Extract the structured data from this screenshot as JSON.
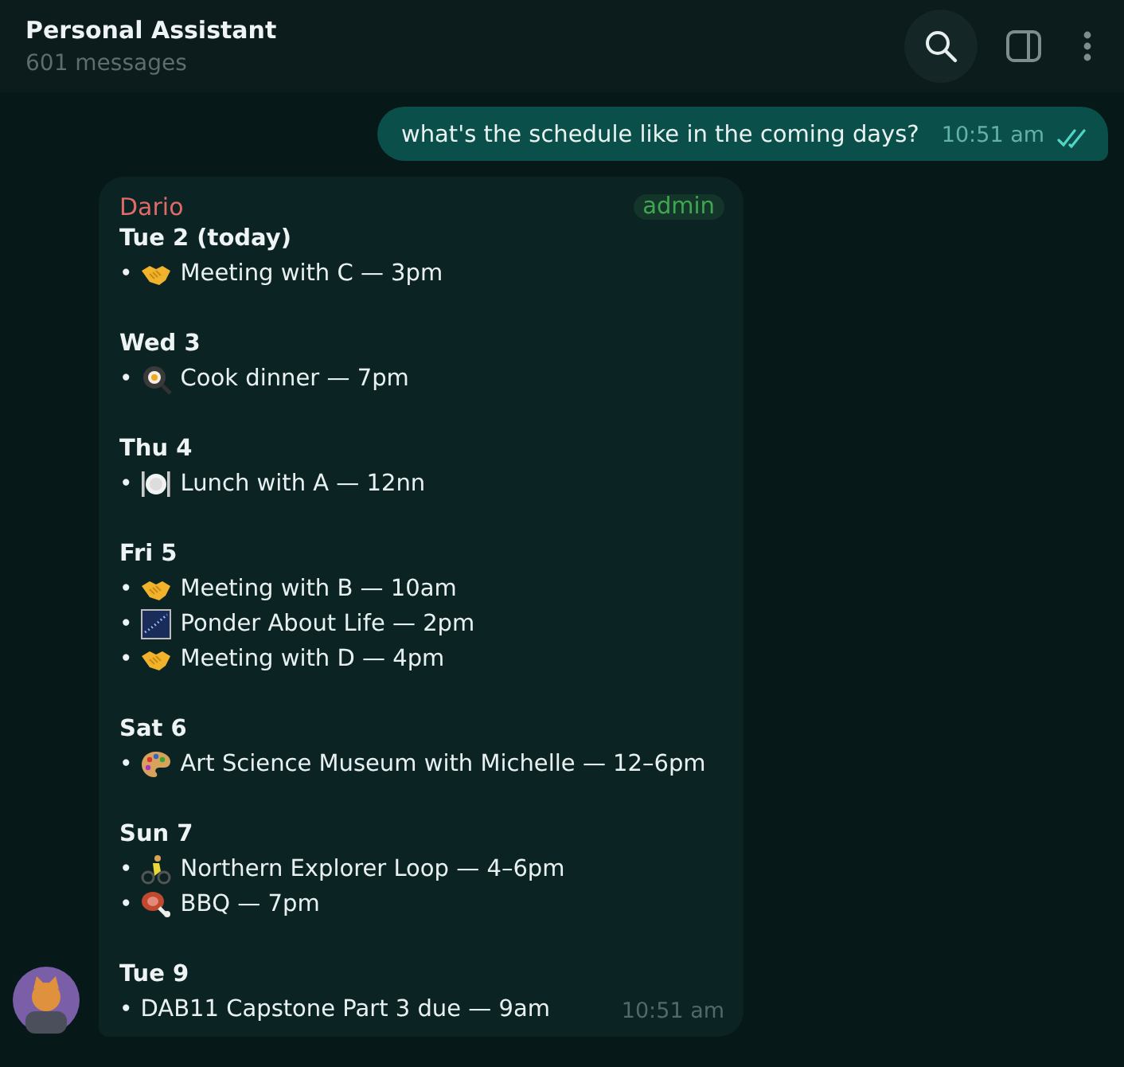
{
  "header": {
    "title": "Personal Assistant",
    "subtitle": "601 messages"
  },
  "outgoing": {
    "text": "what's the schedule like in the coming days?",
    "time": "10:51 am",
    "read": true
  },
  "incoming": {
    "sender": "Dario",
    "badge": "admin",
    "time": "10:51 am",
    "days": [
      {
        "heading": "Tue 2 (today)",
        "items": [
          {
            "bullet": "•",
            "kind": "handshake",
            "text": "Meeting with C — 3pm"
          }
        ]
      },
      {
        "heading": "Wed 3",
        "items": [
          {
            "bullet": "•",
            "kind": "pan",
            "text": "Cook dinner — 7pm"
          }
        ]
      },
      {
        "heading": "Thu 4",
        "items": [
          {
            "bullet": "•",
            "kind": "plate",
            "text": "Lunch with A — 12nn"
          }
        ]
      },
      {
        "heading": "Fri 5",
        "items": [
          {
            "bullet": "•",
            "kind": "handshake",
            "text": "Meeting with B — 10am"
          },
          {
            "bullet": "•",
            "kind": "stars",
            "text": "Ponder About Life — 2pm"
          },
          {
            "bullet": "•",
            "kind": "handshake",
            "text": "Meeting with D — 4pm"
          }
        ]
      },
      {
        "heading": "Sat 6",
        "items": [
          {
            "bullet": "•",
            "kind": "palette",
            "text": "Art Science Museum with Michelle — 12–6pm"
          }
        ]
      },
      {
        "heading": "Sun 7",
        "items": [
          {
            "bullet": "•",
            "kind": "cyclist",
            "text": "Northern Explorer Loop — 4–6pm"
          },
          {
            "bullet": "•",
            "kind": "meat",
            "text": "BBQ — 7pm"
          }
        ]
      },
      {
        "heading": "Tue 9",
        "items": [
          {
            "bullet": "•",
            "kind": "plain",
            "text": "DAB11 Capstone Part 3 due — 9am"
          }
        ]
      }
    ]
  }
}
